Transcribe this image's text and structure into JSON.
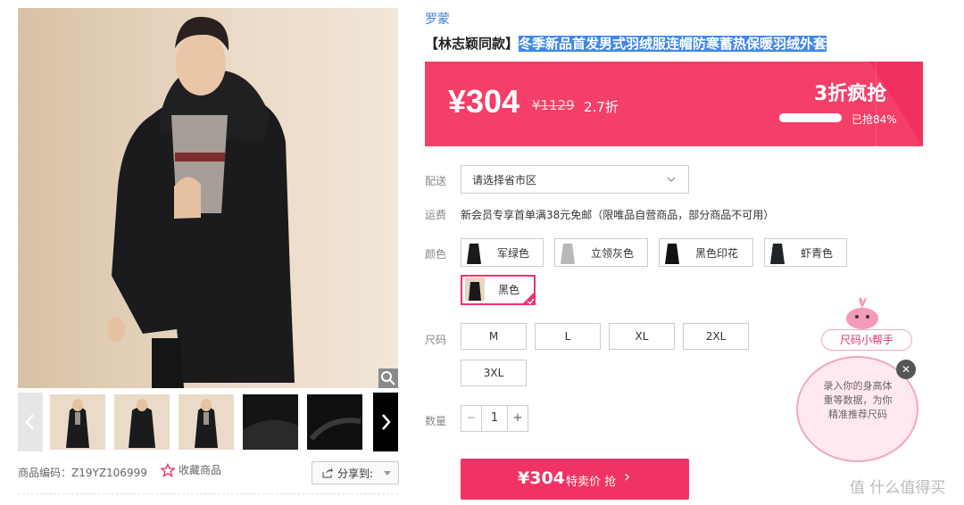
{
  "brand": "罗蒙",
  "title": {
    "prefix": "【林志颖同款】",
    "highlighted": "冬季新品首发男式羽绒服连帽防寒蓄热保暖羽绒外套"
  },
  "price_banner": {
    "price": "¥304",
    "original_price": "¥1129",
    "discount": "2.7折",
    "promo_title": "3折疯抢",
    "progress_percent": 84,
    "progress_text": "已抢84%"
  },
  "delivery": {
    "label": "配送",
    "placeholder": "请选择省市区"
  },
  "shipping": {
    "label": "运费",
    "text": "新会员专享首单满38元免邮（限唯品自营商品，部分商品不可用）"
  },
  "colors": {
    "label": "颜色",
    "options": [
      "军绿色",
      "立领灰色",
      "黑色印花",
      "虾青色",
      "黑色"
    ],
    "selected": "黑色"
  },
  "sizes": {
    "label": "尺码",
    "options": [
      "M",
      "L",
      "XL",
      "2XL",
      "3XL"
    ]
  },
  "quantity": {
    "label": "数量",
    "value": "1",
    "minus": "−",
    "plus": "+"
  },
  "buy_button": {
    "price": "¥304",
    "suffix": "特卖价 抢",
    "chevron": "›"
  },
  "meta": {
    "product_code": "商品编码：Z19YZ106999",
    "favorite": "收藏商品",
    "share": "分享到:"
  },
  "size_helper": {
    "title": "尺码小帮手",
    "text": "录入你的身高体重等数据，为你精准推荐尺码",
    "close": "✕"
  },
  "watermark": "值 什么值得买",
  "icons": {
    "favorite": "star-outline-icon",
    "share": "share-icon",
    "zoom": "magnifier-icon",
    "prev": "chevron-left-icon",
    "next": "chevron-right-icon",
    "dropdown": "chevron-down-icon",
    "close": "close-icon"
  },
  "colors_theme": {
    "accent": "#f43f68",
    "link": "#3a7fd5",
    "selection": "#3f88ee"
  }
}
